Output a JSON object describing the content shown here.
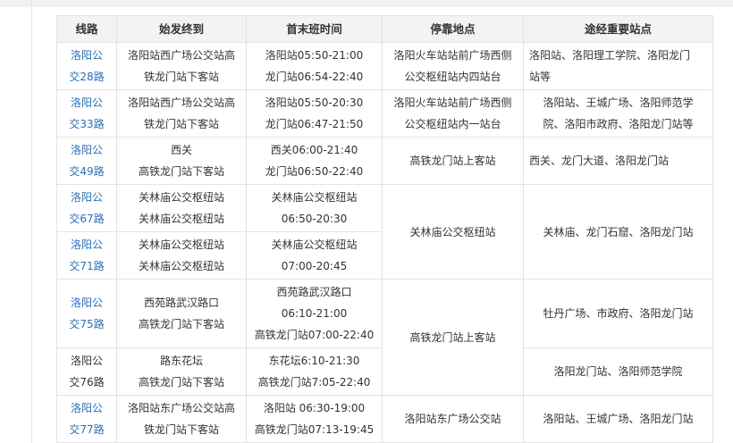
{
  "table": {
    "headers": [
      "线路",
      "始发终到",
      "首末班时间",
      "停靠地点",
      "途经重要站点"
    ],
    "rows": [
      {
        "route": [
          "洛阳公",
          "交28路"
        ],
        "endpoints": [
          "洛阳站西广场公交站高",
          "铁龙门站下客站"
        ],
        "times": [
          "洛阳站05:50-21:00",
          "龙门站06:54-22:40"
        ],
        "stop": [
          "洛阳火车站站前广场西侧",
          "公交枢纽站内四站台"
        ],
        "via": [
          "洛阳站、洛阳理工学院、洛阳龙门",
          "站等"
        ]
      },
      {
        "route": [
          "洛阳公",
          "交33路"
        ],
        "endpoints": [
          "洛阳站西广场公交站高",
          "铁龙门站下客站"
        ],
        "times": [
          "洛阳站05:50-20:30",
          "龙门站06:47-21:50"
        ],
        "stop": [
          "洛阳火车站站前广场西侧",
          "公交枢纽站内一站台"
        ],
        "via": [
          "洛阳站、王城广场、洛阳师范学",
          "院、洛阳市政府、洛阳龙门站等"
        ]
      },
      {
        "route": [
          "洛阳公",
          "交49路"
        ],
        "endpoints": [
          "西关",
          "高铁龙门站下客站"
        ],
        "times": [
          "西关06:00-21:40",
          "龙门站06:50-22:40"
        ],
        "stop": [
          "高铁龙门站上客站"
        ],
        "via": [
          "西关、龙门大道、洛阳龙门站"
        ]
      },
      {
        "route": [
          "洛阳公",
          "交67路"
        ],
        "endpoints": [
          "关林庙公交枢纽站",
          "关林庙公交枢纽站"
        ],
        "times": [
          "关林庙公交枢纽站",
          "06:50-20:30"
        ]
      },
      {
        "route": [
          "洛阳公",
          "交71路"
        ],
        "endpoints": [
          "关林庙公交枢纽站",
          "关林庙公交枢纽站"
        ],
        "times": [
          "关林庙公交枢纽站",
          "07:00-20:45"
        ]
      },
      {
        "route": [
          "洛阳公",
          "交75路"
        ],
        "endpoints": [
          "西苑路武汉路口",
          "高铁龙门站下客站"
        ],
        "times": [
          "西苑路武汉路口",
          "06:10-21:00",
          "高铁龙门站07:00-22:40"
        ]
      },
      {
        "route": [
          "洛阳公",
          "交76路"
        ],
        "endpoints": [
          "路东花坛",
          "高铁龙门站下客站"
        ],
        "times": [
          "东花坛6:10-21:30",
          "高铁龙门站7:05-22:40"
        ],
        "via": [
          "洛阳龙门站、洛阳师范学院"
        ]
      },
      {
        "route": [
          "洛阳公",
          "交77路"
        ],
        "endpoints": [
          "洛阳站东广场公交站高",
          "铁龙门站下客站"
        ],
        "times": [
          "洛阳站 06:30-19:00",
          "高铁龙门站07:13-19:45"
        ],
        "stop": [
          "洛阳站东广场公交站"
        ],
        "via": [
          "洛阳站、王城广场、洛阳龙门站"
        ]
      }
    ],
    "merged": {
      "stop_67_71": "关林庙公交枢纽站",
      "via_67_71": "关林庙、龙门石窟、洛阳龙门站",
      "stop_75_76": "高铁龙门站上客站",
      "via_75": "牡丹广场、市政府、洛阳龙门站"
    }
  }
}
